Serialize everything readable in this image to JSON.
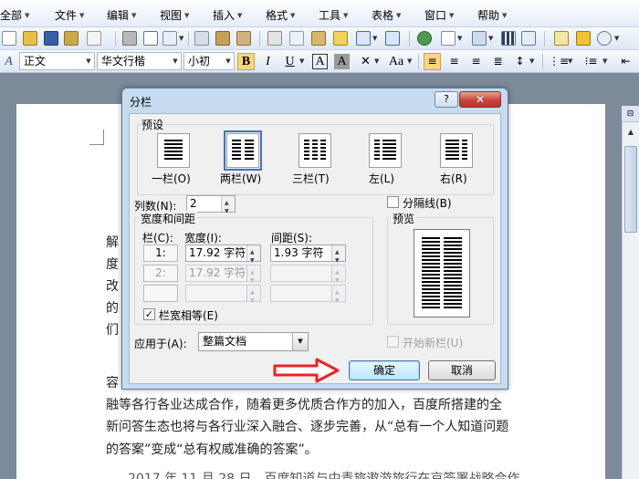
{
  "menu": {
    "items": [
      "全部",
      "文件",
      "编辑",
      "视图",
      "插入",
      "格式",
      "工具",
      "表格",
      "窗口",
      "帮助"
    ]
  },
  "format_toolbar": {
    "style": "正文",
    "font": "华文行楷",
    "size": "小初",
    "bold": "B",
    "italic": "I",
    "underline": "U",
    "char_border": "A",
    "char_shade": "A",
    "case": "Aa"
  },
  "icons": [
    "new-doc-icon",
    "open-icon",
    "save-icon",
    "permission-icon",
    "print-icon",
    "print-preview-icon",
    "spelling-icon",
    "research-icon",
    "cut-icon",
    "copy-icon",
    "paste-icon",
    "format-painter-icon",
    "undo-icon",
    "redo-icon",
    "hyperlink-icon",
    "table-icon",
    "columns-icon",
    "zoom-icon"
  ],
  "document": {
    "frag1": "解",
    "frag2": "度",
    "frag3": "改",
    "frag4": "的",
    "frag5": "们",
    "frag6": "容",
    "line1": "融等各行各业达成合作，随着更多优质合作方的加入，百度所搭建的全",
    "line2": "新问答生态也将与各行业深入融合、逐步完善，从“总有一个人知道问题",
    "line3": "的答案”变成“总有权威准确的答案”。",
    "line4": "2017 年 11 月 28 日，百度知道与中青旅遨游旅行在京签署战略合作"
  },
  "dialog": {
    "title": "分栏",
    "help": "?",
    "close": "✕",
    "presets_label": "预设",
    "presets": [
      {
        "label": "一栏(O)"
      },
      {
        "label": "两栏(W)"
      },
      {
        "label": "三栏(T)"
      },
      {
        "label": "左(L)"
      },
      {
        "label": "右(R)"
      }
    ],
    "num_cols_label": "列数(N):",
    "num_cols_value": "2",
    "separator_label": "分隔线(B)",
    "width_spacing_label": "宽度和间距",
    "col_header": "栏(C):",
    "width_header": "宽度(I):",
    "spacing_header": "间距(S):",
    "rows": [
      {
        "col": "1:",
        "width": "17.92 字符",
        "spacing": "1.93 字符"
      },
      {
        "col": "2:",
        "width": "17.92 字符",
        "spacing": ""
      },
      {
        "col": "",
        "width": "",
        "spacing": ""
      }
    ],
    "equal_width_label": "栏宽相等(E)",
    "equal_width_checked": "✓",
    "preview_label": "预览",
    "apply_label": "应用于(A):",
    "apply_value": "整篇文档",
    "new_column_label": "开始新栏(U)",
    "ok_label": "确定",
    "cancel_label": "取消"
  },
  "colors": {
    "accent_arrow": "#e8242a",
    "dialog_frame": "#c7dbf0",
    "close_button": "#c7463a"
  }
}
